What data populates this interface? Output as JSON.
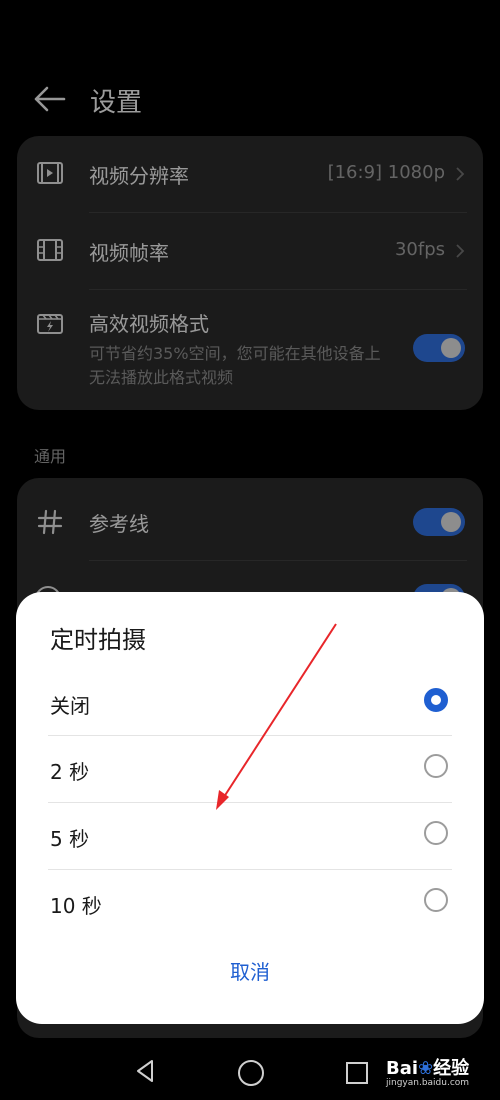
{
  "header": {
    "title": "设置"
  },
  "settings": {
    "resolution": {
      "label": "视频分辨率",
      "value": "[16:9] 1080p"
    },
    "framerate": {
      "label": "视频帧率",
      "value": "30fps"
    },
    "efficient": {
      "label": "高效视频格式",
      "desc": "可节省约35%空间，您可能在其他设备上无法播放此格式视频",
      "on": true
    }
  },
  "general": {
    "section_label": "通用",
    "grid": {
      "label": "参考线",
      "on": true
    }
  },
  "dialog": {
    "title": "定时拍摄",
    "options": [
      {
        "label": "关闭",
        "selected": true
      },
      {
        "label": "2 秒",
        "selected": false
      },
      {
        "label": "5 秒",
        "selected": false
      },
      {
        "label": "10 秒",
        "selected": false
      }
    ],
    "cancel": "取消"
  },
  "annotation": {
    "color": "#e8262a"
  },
  "watermark": {
    "logo": "Bai",
    "logo_tail": "经验",
    "url": "jingyan.baidu.com"
  },
  "colors": {
    "accent": "#1f5fd1",
    "toggle_on": "#2f6ddb",
    "card_bg": "#2a2a2a"
  }
}
